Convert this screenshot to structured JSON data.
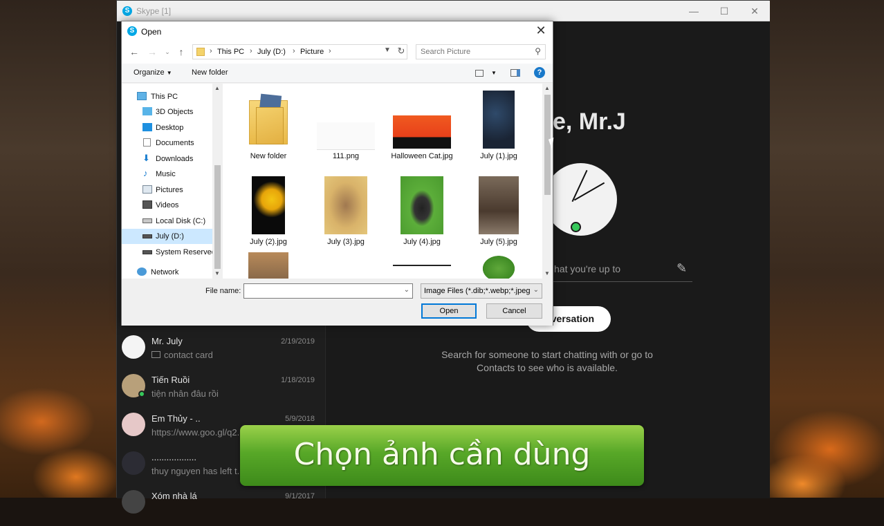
{
  "skype": {
    "title": "Skype [1]",
    "greeting": "e, Mr.J",
    "mood_placeholder": "hat you're up to",
    "conversation_button": "versation",
    "hint_line1": "Search for someone to start chatting with or go to",
    "hint_line2": "Contacts to see who is available.",
    "chats": [
      {
        "name": "Mr. July",
        "date": "2/19/2019",
        "preview": "contact card"
      },
      {
        "name": "Tiến Ruồi",
        "date": "1/18/2019",
        "preview": "tiện nhân đâu rồi"
      },
      {
        "name": "Em Thủy - ..",
        "date": "5/9/2018",
        "preview": "https://www.goo.gl/q2..."
      },
      {
        "name": "..................",
        "date": "",
        "preview": "thuy nguyen has left t..."
      },
      {
        "name": "Xóm nhà lá",
        "date": "9/1/2017",
        "preview": ""
      }
    ]
  },
  "dialog": {
    "title": "Open",
    "breadcrumb": [
      "This PC",
      "July (D:)",
      "Picture"
    ],
    "search_placeholder": "Search Picture",
    "organize_label": "Organize",
    "new_folder_label": "New folder",
    "tree": [
      {
        "label": "This PC",
        "icon": "pc-icon"
      },
      {
        "label": "3D Objects",
        "icon": "cube-icon"
      },
      {
        "label": "Desktop",
        "icon": "desktop-icon"
      },
      {
        "label": "Documents",
        "icon": "document-icon"
      },
      {
        "label": "Downloads",
        "icon": "download-icon"
      },
      {
        "label": "Music",
        "icon": "music-icon"
      },
      {
        "label": "Pictures",
        "icon": "pictures-icon"
      },
      {
        "label": "Videos",
        "icon": "video-icon"
      },
      {
        "label": "Local Disk (C:)",
        "icon": "disk-icon"
      },
      {
        "label": "July (D:)",
        "icon": "drive-icon"
      },
      {
        "label": "System Reserved",
        "icon": "drive-icon"
      },
      {
        "label": "Network",
        "icon": "network-icon"
      }
    ],
    "files": [
      {
        "name": "New folder"
      },
      {
        "name": "111.png"
      },
      {
        "name": "Halloween Cat.jpg"
      },
      {
        "name": "July (1).jpg"
      },
      {
        "name": "July (2).jpg"
      },
      {
        "name": "July (3).jpg"
      },
      {
        "name": "July (4).jpg"
      },
      {
        "name": "July (5).jpg"
      }
    ],
    "file_name_label": "File name:",
    "file_name_value": "",
    "file_type_value": "Image Files (*.dib;*.webp;*.jpeg",
    "open_label": "Open",
    "cancel_label": "Cancel"
  },
  "caption": "Chọn ảnh cần dùng"
}
